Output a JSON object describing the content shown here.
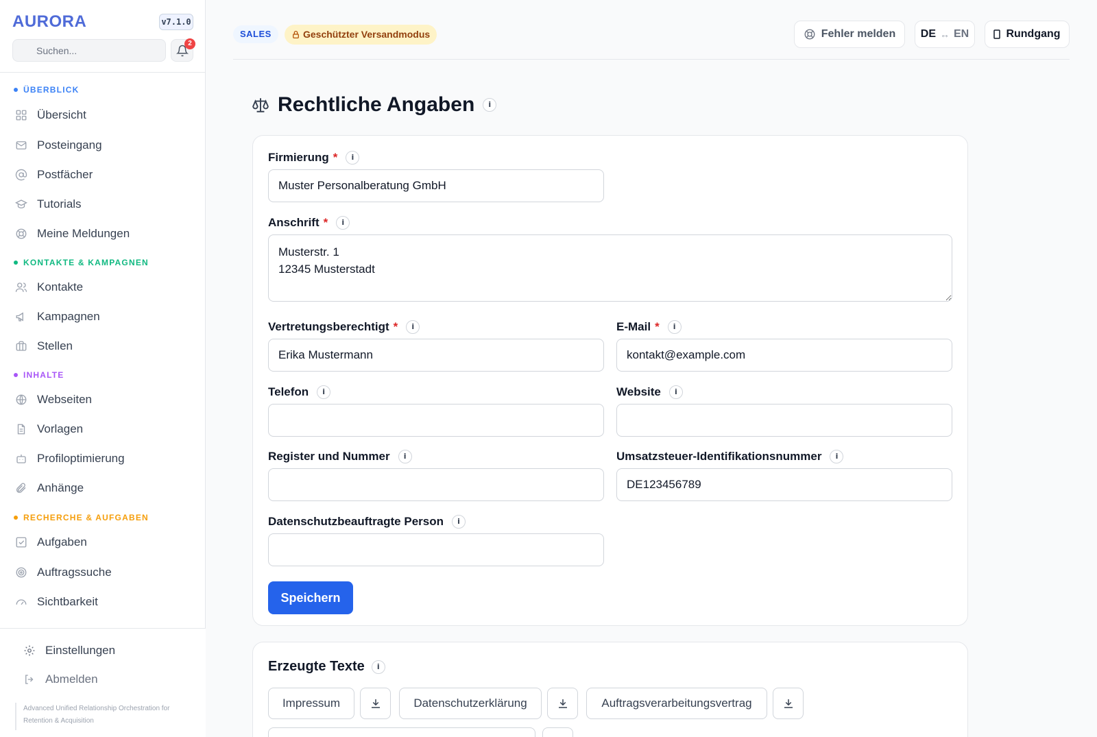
{
  "app": {
    "logo": "AURORA",
    "version": "v7.1.0",
    "search_placeholder": "Suchen...",
    "notification_count": "2",
    "tagline": "Advanced Unified Relationship Orchestration for Retention & Acquisition"
  },
  "sidebar": {
    "sections": [
      {
        "label": "ÜBERBLICK",
        "color": "#3b82f6",
        "items": [
          {
            "label": "Übersicht",
            "icon": "grid-icon"
          },
          {
            "label": "Posteingang",
            "icon": "mail-icon"
          },
          {
            "label": "Postfächer",
            "icon": "at-icon"
          },
          {
            "label": "Tutorials",
            "icon": "graduation-icon"
          },
          {
            "label": "Meine Meldungen",
            "icon": "lifebuoy-icon"
          }
        ]
      },
      {
        "label": "KONTAKTE & KAMPAGNEN",
        "color": "#10b981",
        "items": [
          {
            "label": "Kontakte",
            "icon": "users-icon"
          },
          {
            "label": "Kampagnen",
            "icon": "megaphone-icon"
          },
          {
            "label": "Stellen",
            "icon": "briefcase-icon"
          }
        ]
      },
      {
        "label": "INHALTE",
        "color": "#a855f7",
        "items": [
          {
            "label": "Webseiten",
            "icon": "globe-icon"
          },
          {
            "label": "Vorlagen",
            "icon": "file-icon"
          },
          {
            "label": "Profiloptimierung",
            "icon": "bot-icon"
          },
          {
            "label": "Anhänge",
            "icon": "paperclip-icon"
          }
        ]
      },
      {
        "label": "RECHERCHE & AUFGABEN",
        "color": "#f59e0b",
        "items": [
          {
            "label": "Aufgaben",
            "icon": "checkbox-icon"
          },
          {
            "label": "Auftragssuche",
            "icon": "target-icon"
          },
          {
            "label": "Sichtbarkeit",
            "icon": "gauge-icon"
          }
        ]
      }
    ],
    "bottom": {
      "settings": "Einstellungen",
      "logout": "Abmelden"
    }
  },
  "header": {
    "sales_badge": "SALES",
    "mode_badge": "Geschützter Versandmodus",
    "report_button": "Fehler melden",
    "lang_from": "DE",
    "lang_arrow": "↔",
    "lang_to": "EN",
    "tour_button": "Rundgang"
  },
  "page": {
    "title": "Rechtliche Angaben"
  },
  "form": {
    "firmierung": {
      "label": "Firmierung",
      "value": "Muster Personalberatung GmbH"
    },
    "anschrift": {
      "label": "Anschrift",
      "value": "Musterstr. 1\n12345 Musterstadt"
    },
    "vertretung": {
      "label": "Vertretungsberechtigt",
      "value": "Erika Mustermann"
    },
    "email": {
      "label": "E-Mail",
      "value": "kontakt@example.com"
    },
    "telefon": {
      "label": "Telefon",
      "value": ""
    },
    "website": {
      "label": "Website",
      "value": ""
    },
    "register": {
      "label": "Register und Nummer",
      "value": ""
    },
    "ustid": {
      "label": "Umsatzsteuer-Identifikationsnummer",
      "value": "DE123456789"
    },
    "datenschutz": {
      "label": "Datenschutzbeauftragte Person",
      "value": ""
    },
    "required_mark": "*",
    "info_mark": "i",
    "save_label": "Speichern"
  },
  "generated": {
    "title": "Erzeugte Texte",
    "buttons": [
      "Impressum",
      "Datenschutzerklärung",
      "Auftragsverarbeitungsvertrag"
    ]
  },
  "colors": {
    "primary": "#2563eb",
    "logo": "#4f6bd8",
    "required": "#dc2626"
  }
}
